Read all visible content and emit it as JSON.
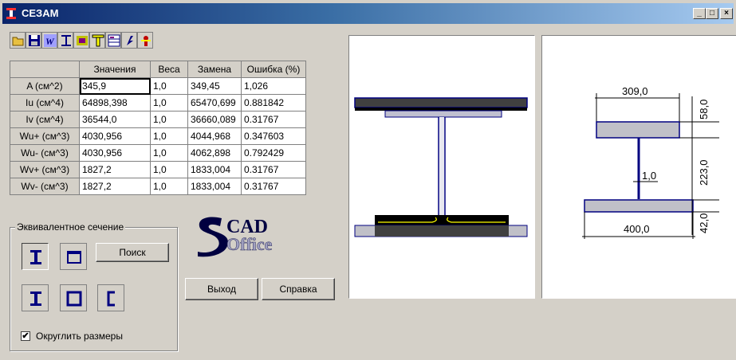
{
  "window": {
    "title": "СЕЗАМ",
    "minimize_icon": "minimize-icon",
    "maximize_icon": "maximize-icon",
    "close_icon": "close-icon"
  },
  "toolbar": {
    "icons": [
      "open-folder-icon",
      "save-icon",
      "w-section-icon",
      "i-beam-icon",
      "assembly-icon",
      "tee-icon",
      "table-icon",
      "arrow-icon",
      "exit-icon"
    ]
  },
  "grid": {
    "headers": [
      "",
      "Значения",
      "Веса",
      "Замена",
      "Ошибка (%)"
    ],
    "rows": [
      {
        "label": "A  (см^2)",
        "value": "345,9",
        "weight": "1,0",
        "replace": "349,45",
        "error": "1,026"
      },
      {
        "label": "Iu  (см^4)",
        "value": "64898,398",
        "weight": "1,0",
        "replace": "65470,699",
        "error": "0.881842"
      },
      {
        "label": "Iv  (см^4)",
        "value": "36544,0",
        "weight": "1,0",
        "replace": "36660,089",
        "error": "0.31767"
      },
      {
        "label": "Wu+ (см^3)",
        "value": "4030,956",
        "weight": "1,0",
        "replace": "4044,968",
        "error": "0.347603"
      },
      {
        "label": "Wu- (см^3)",
        "value": "4030,956",
        "weight": "1,0",
        "replace": "4062,898",
        "error": "0.792429"
      },
      {
        "label": "Wv+ (см^3)",
        "value": "1827,2",
        "weight": "1,0",
        "replace": "1833,004",
        "error": "0.31767"
      },
      {
        "label": "Wv- (см^3)",
        "value": "1827,2",
        "weight": "1,0",
        "replace": "1833,004",
        "error": "0.31767"
      }
    ]
  },
  "equivalent": {
    "legend": "Эквивалентное сечение",
    "search_label": "Поиск",
    "round_label": "Округлить размеры",
    "round_checked": "✔"
  },
  "logo": {
    "top": "CAD",
    "bottom": "Office"
  },
  "buttons": {
    "exit": "Выход",
    "help": "Справка"
  },
  "drawing": {
    "top_width": "309,0",
    "bottom_width": "400,0",
    "web_thickness": "1,0",
    "top_flange_h": "58,0",
    "web_h": "223,0",
    "bottom_flange_h": "42,0"
  }
}
